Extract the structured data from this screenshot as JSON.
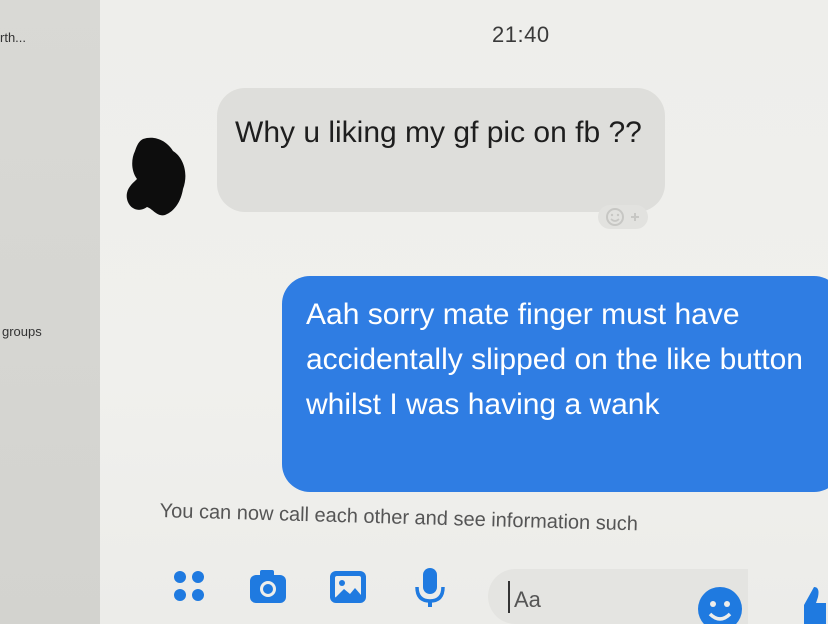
{
  "sidebar": {
    "truncated_label": "rth...",
    "groups_label": "groups"
  },
  "conversation": {
    "timestamp": "21:40",
    "messages": [
      {
        "direction": "incoming",
        "text": "Why u liking my gf pic on fb ??"
      },
      {
        "direction": "outgoing",
        "text": "Aah sorry mate finger must have accidentally slipped on the like button whilst I was having a wank"
      }
    ],
    "info_notice": "You can now call each other and see information such"
  },
  "composer": {
    "input_placeholder": "Aa",
    "icons": [
      "apps-icon",
      "camera-icon",
      "gallery-icon",
      "microphone-icon",
      "emoji-icon"
    ]
  },
  "colors": {
    "outgoing_bubble": "#2f7de3",
    "incoming_bubble": "#dededb",
    "accent": "#1f7ae0"
  }
}
